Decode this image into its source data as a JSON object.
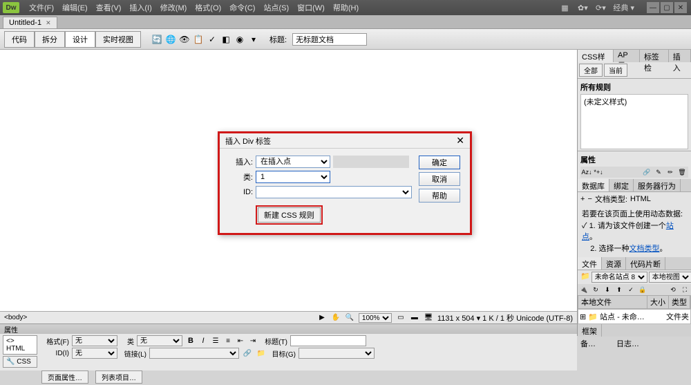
{
  "app": {
    "logo": "Dw",
    "layout_mode": "经典"
  },
  "menu": {
    "file": "文件(F)",
    "edit": "编辑(E)",
    "view": "查看(V)",
    "insert": "插入(I)",
    "modify": "修改(M)",
    "format": "格式(O)",
    "commands": "命令(C)",
    "site": "站点(S)",
    "window": "窗口(W)",
    "help": "帮助(H)"
  },
  "win_controls": {
    "min": "—",
    "max": "▢",
    "close": "✕"
  },
  "tabs": {
    "doc1": "Untitled-1",
    "close": "✕"
  },
  "toolbar": {
    "code": "代码",
    "split": "拆分",
    "design": "设计",
    "live": "实时视图",
    "title_label": "标题:",
    "title_value": "无标题文档"
  },
  "dialog": {
    "title": "插入 Div 标签",
    "insert_label": "插入:",
    "insert_value": "在插入点",
    "class_label": "类:",
    "class_value": "1",
    "id_label": "ID:",
    "new_css_btn": "新建 CSS 规则",
    "ok": "确定",
    "cancel": "取消",
    "help": "帮助",
    "close": "✕"
  },
  "status": {
    "tag": "<body>",
    "zoom": "100%",
    "info": "1131 x 504 ▾ 1 K / 1 秒 Unicode (UTF-8)"
  },
  "props": {
    "header": "属性",
    "tab_html": "<> HTML",
    "tab_css": "🔧 CSS",
    "format_label": "格式(F)",
    "format_value": "无",
    "id_label": "ID(I)",
    "id_value": "无",
    "class_label": "类",
    "class_value": "无",
    "link_label": "链接(L)",
    "title_label": "标题(T)",
    "target_label": "目标(G)",
    "page_props": "页面属性…",
    "list_item": "列表项目…"
  },
  "right": {
    "css_tab": "CSS样式",
    "ap_tab": "AP 元",
    "tags_tab": "标签检",
    "insert_tab": "插入",
    "all": "全部",
    "current": "当前",
    "all_rules": "所有规则",
    "no_style": "(未定义样式)",
    "props_header": "属性",
    "db_tab": "数据库",
    "bind_tab": "绑定",
    "server_tab": "服务器行为",
    "doc_type_label": "文档类型:",
    "doc_type_value": "HTML",
    "notice_intro": "若要在该页面上使用动态数据:",
    "notice_1": "请为该文件创建一个",
    "notice_1_link": "站点",
    "notice_1_end": "。",
    "notice_2": "选择一种",
    "notice_2_link": "文档类型",
    "notice_2_end": "。",
    "files_tab": "文件",
    "assets_tab": "资源",
    "snippets_tab": "代码片断",
    "site_sel": "未命名站点 8",
    "view_sel": "本地视图",
    "col_local": "本地文件",
    "col_size": "大小",
    "col_type": "类型",
    "site_root": "站点 - 未命…",
    "folder_type": "文件夹",
    "frame_header": "框架",
    "backup_label": "备…",
    "log_label": "日志…"
  }
}
